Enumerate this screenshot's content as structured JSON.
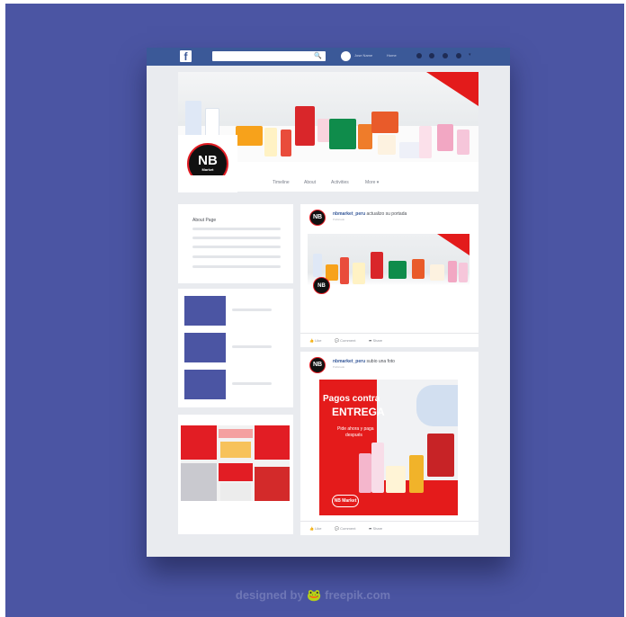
{
  "topbar": {
    "logo": "f",
    "search_icon": "🔍",
    "user_name": "Jose Name",
    "home_label": "Home"
  },
  "profile": {
    "logo_initials": "NB",
    "logo_sub": "Market"
  },
  "tabs": [
    "Timeline",
    "About",
    "Activities",
    "More ▾"
  ],
  "about_panel": {
    "title": "About Page"
  },
  "posts": [
    {
      "author": "nbmarket_peru",
      "action": "actualizo su portada",
      "time": "Publicado",
      "logo_initials": "NB",
      "actions": {
        "like": "Like",
        "comment": "Comment",
        "share": "Share"
      }
    },
    {
      "author": "nbmarket_peru",
      "action": "subio una foto",
      "time": "Publicado",
      "logo_initials": "NB",
      "promo": {
        "line1": "Pagos contra",
        "line2": "ENTREGA",
        "line3": "Pide ahora y paga",
        "line4": "después",
        "brand": "NB Market"
      },
      "actions": {
        "like": "Like",
        "comment": "Comment",
        "share": "Share"
      }
    }
  ],
  "credit": "designed by 🐸 freepik.com",
  "colors": {
    "background": "#4b55a3",
    "topbar": "#3b5998",
    "brand_red": "#e21d24",
    "card": "#e9ebef"
  }
}
